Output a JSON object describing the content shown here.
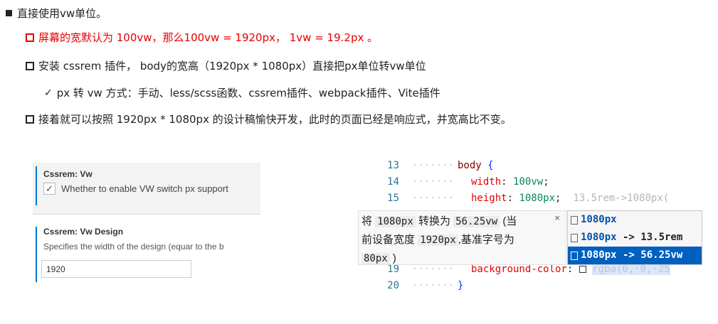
{
  "bullets": {
    "b1": "直接使用vw单位。",
    "b2": "屏幕的宽默认为 100vw，那么100vw = 1920px， 1vw = 19.2px 。",
    "b3": "安装 cssrem 插件， body的宽高（1920px * 1080px）直接把px单位转vw单位",
    "b4_check": "✓",
    "b4": "px 转 vw 方式：手动、less/scss函数、cssrem插件、webpack插件、Vite插件",
    "b5": "接着就可以按照 1920px * 1080px 的设计稿愉快开发，此时的页面已经是响应式，并宽高比不变。"
  },
  "colors": {
    "accent_red": "#e60000",
    "vscode_blue": "#0078d4",
    "suggest_active": "#0060c0"
  },
  "settings": {
    "vw_title": "Cssrem: Vw",
    "vw_checked": "✓",
    "vw_desc": "Whether to enable VW switch px support",
    "design_title": "Cssrem: Vw Design",
    "design_desc": "Specifies the width of the design (equar to the b",
    "design_value": "1920"
  },
  "editor": {
    "lines": [
      {
        "num": "13",
        "dots": "·······",
        "text": "body"
      },
      {
        "num": "14",
        "dots": "·······",
        "text": "width"
      },
      {
        "num": "15",
        "dots": "·······",
        "text": "height"
      },
      {
        "num": "19",
        "dots": "·······",
        "text": "background-color"
      },
      {
        "num": "20",
        "dots": "·······",
        "text": "}"
      }
    ],
    "l13_sel": "body",
    "l13_brace": "{",
    "l14_prop": "width",
    "l14_colon": ":",
    "l14_val": "100vw",
    "l14_semi": ";",
    "l15_prop": "height",
    "l15_colon": ":",
    "l15_val": "1080px",
    "l15_semi": ";",
    "l15_hint": "13.5rem->1080px(",
    "l19_prop": "background-color",
    "l19_colon": ":",
    "l19_val": "rgba(0,·0,·25",
    "l20_brace": "}",
    "icon": "color-swatch-icon"
  },
  "popup": {
    "part1": "将",
    "code1": "1080px",
    "part2": "转换为",
    "code2": "56.25vw",
    "part3": "(当",
    "part4": "前设备宽度",
    "code3": "1920px",
    "part5": ",基准字号为",
    "code4": "80px",
    "part6": ")",
    "close": "×"
  },
  "suggest": {
    "items": [
      {
        "label": "1080px",
        "detail": ""
      },
      {
        "label": "1080px",
        "detail": " -> 13.5rem"
      },
      {
        "label": "1080px",
        "detail": " -> 56.25vw"
      }
    ]
  }
}
